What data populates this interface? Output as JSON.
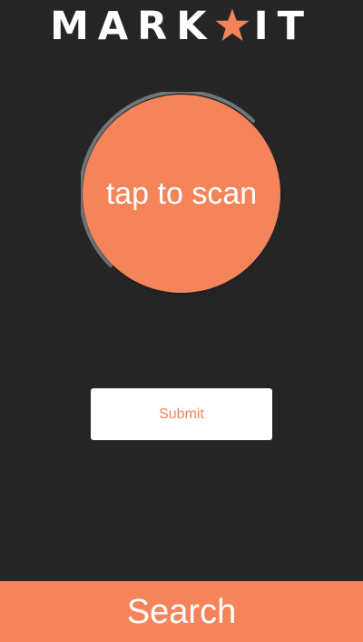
{
  "app": {
    "brand": {
      "left": "MARK",
      "right": "IT"
    }
  },
  "colors": {
    "background": "#252525",
    "accent": "#f5845b",
    "text": "#ffffff",
    "ring": "#6f777a",
    "button_background": "#ffffff"
  },
  "scan": {
    "label": "tap to scan"
  },
  "form": {
    "submit_label": "Submit"
  },
  "navigation": {
    "search_label": "Search"
  },
  "icons": {
    "logo": "star-icon"
  }
}
